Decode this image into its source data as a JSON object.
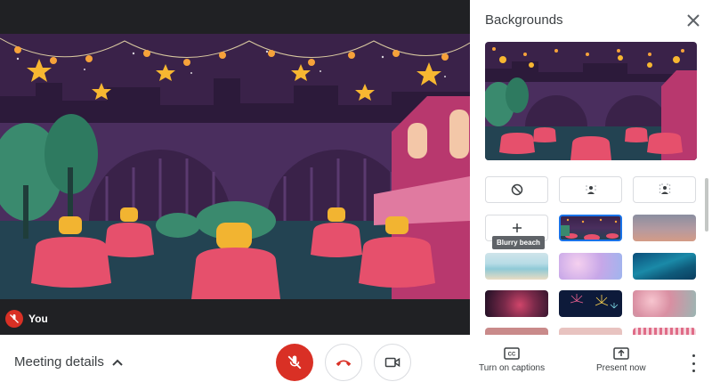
{
  "video": {
    "participant_name": "You"
  },
  "bottom_bar": {
    "meeting_details_label": "Meeting details"
  },
  "panel": {
    "title": "Backgrounds",
    "tooltip": "Blurry beach"
  },
  "actions": {
    "captions_label": "Turn on captions",
    "present_label": "Present now",
    "captions_icon_text": "CC"
  },
  "colors": {
    "scene_sky": "#3a2249",
    "mic_off_red": "#d93025",
    "table_pink": "#e6506c"
  },
  "icons": [
    "mic-off-icon",
    "hang-up-icon",
    "camera-icon",
    "close-icon",
    "no-effect-icon",
    "blur-slight-icon",
    "blur-strong-icon",
    "add-icon",
    "chevron-up-icon",
    "captions-icon",
    "present-icon",
    "more-vert-icon"
  ]
}
